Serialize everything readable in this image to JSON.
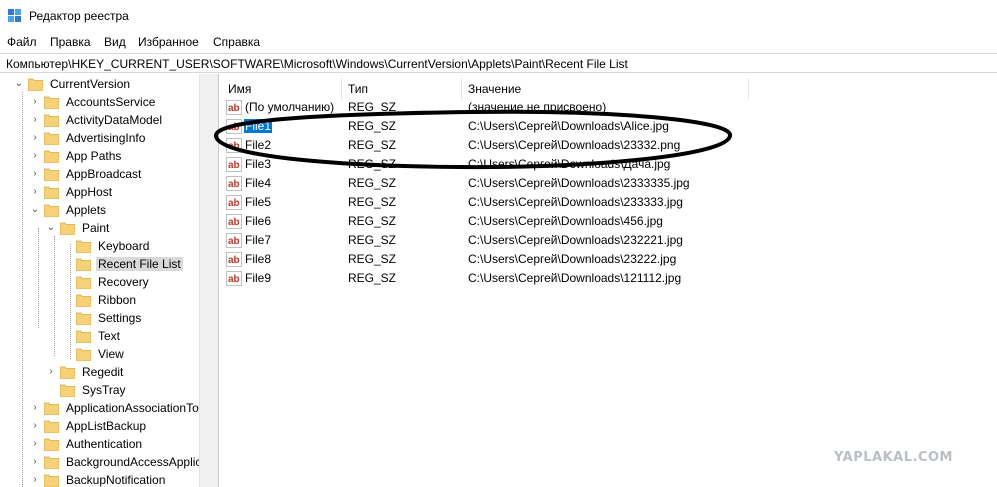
{
  "window": {
    "title": "Редактор реестра",
    "icon": "regedit-icon"
  },
  "menu": [
    {
      "label": "Файл"
    },
    {
      "label": "Правка"
    },
    {
      "label": "Вид"
    },
    {
      "label": "Избранное"
    },
    {
      "label": "Справка"
    }
  ],
  "address": {
    "path": "Компьютер\\HKEY_CURRENT_USER\\SOFTWARE\\Microsoft\\Windows\\CurrentVersion\\Applets\\Paint\\Recent File List"
  },
  "tree": [
    {
      "label": "CurrentVersion",
      "expanded": true
    },
    {
      "label": "AccountsService"
    },
    {
      "label": "ActivityDataModel"
    },
    {
      "label": "AdvertisingInfo"
    },
    {
      "label": "App Paths"
    },
    {
      "label": "AppBroadcast"
    },
    {
      "label": "AppHost"
    },
    {
      "label": "Applets",
      "expanded": true
    },
    {
      "label": "Paint",
      "expanded": true
    },
    {
      "label": "Keyboard"
    },
    {
      "label": "Recent File List",
      "selected": true
    },
    {
      "label": "Recovery"
    },
    {
      "label": "Ribbon"
    },
    {
      "label": "Settings"
    },
    {
      "label": "Text"
    },
    {
      "label": "View"
    },
    {
      "label": "Regedit"
    },
    {
      "label": "SysTray"
    },
    {
      "label": "ApplicationAssociationTo"
    },
    {
      "label": "AppListBackup"
    },
    {
      "label": "Authentication"
    },
    {
      "label": "BackgroundAccessApplic"
    },
    {
      "label": "BackupNotification"
    }
  ],
  "list": {
    "columns": {
      "name": "Имя",
      "type": "Тип",
      "value": "Значение"
    },
    "rows": [
      {
        "name": "(По умолчанию)",
        "type": "REG_SZ",
        "value": "(значение не присвоено)"
      },
      {
        "name": "File1",
        "type": "REG_SZ",
        "value": "C:\\Users\\Сергей\\Downloads\\Alice.jpg",
        "selected": true
      },
      {
        "name": "File2",
        "type": "REG_SZ",
        "value": "C:\\Users\\Сергей\\Downloads\\23332.png"
      },
      {
        "name": "File3",
        "type": "REG_SZ",
        "value": "C:\\Users\\Сергей\\Downloads\\Дача.jpg"
      },
      {
        "name": "File4",
        "type": "REG_SZ",
        "value": "C:\\Users\\Сергей\\Downloads\\2333335.jpg"
      },
      {
        "name": "File5",
        "type": "REG_SZ",
        "value": "C:\\Users\\Сергей\\Downloads\\233333.jpg"
      },
      {
        "name": "File6",
        "type": "REG_SZ",
        "value": "C:\\Users\\Сергей\\Downloads\\456.jpg"
      },
      {
        "name": "File7",
        "type": "REG_SZ",
        "value": "C:\\Users\\Сергей\\Downloads\\232221.jpg"
      },
      {
        "name": "File8",
        "type": "REG_SZ",
        "value": "C:\\Users\\Сергей\\Downloads\\23222.jpg"
      },
      {
        "name": "File9",
        "type": "REG_SZ",
        "value": "C:\\Users\\Сергей\\Downloads\\121112.jpg"
      }
    ]
  },
  "watermark": "YAPLAKAL.COM",
  "colors": {
    "folder": "#f5d27a",
    "selection": "#0078d7",
    "annotation": "#000000"
  }
}
